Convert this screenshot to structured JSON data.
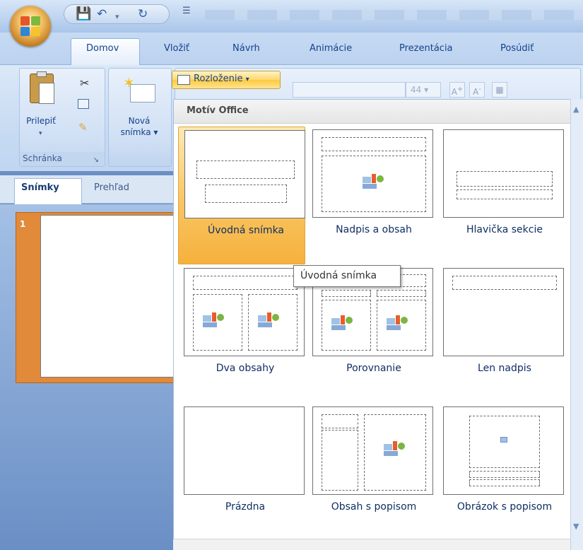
{
  "tabs": [
    "Domov",
    "Vložiť",
    "Návrh",
    "Animácie",
    "Prezentácia",
    "Posúdiť"
  ],
  "ribbon": {
    "paste_label": "Prilepiť",
    "clipboard_group": "Schránka",
    "new_slide_label_1": "Nová",
    "new_slide_label_2": "snímka",
    "layout_button": "Rozloženie",
    "font_size": "44"
  },
  "pane": {
    "tab_slides": "Snímky",
    "tab_outline": "Prehľad",
    "slide_number": "1"
  },
  "gallery": {
    "header": "Motív Office",
    "layouts": [
      {
        "name": "Úvodná snímka",
        "selected": true
      },
      {
        "name": "Nadpis a obsah"
      },
      {
        "name": "Hlavička sekcie"
      },
      {
        "name": "Dva obsahy"
      },
      {
        "name": "Porovnanie"
      },
      {
        "name": "Len nadpis"
      },
      {
        "name": "Prázdna"
      },
      {
        "name": "Obsah s popisom"
      },
      {
        "name": "Obrázok s popisom"
      }
    ]
  },
  "tooltip": "Úvodná snímka",
  "colors": {
    "selected_fill": "#f9c562",
    "ribbon_blue": "#c5d9f2",
    "thumb_orange": "#e08a3a"
  }
}
